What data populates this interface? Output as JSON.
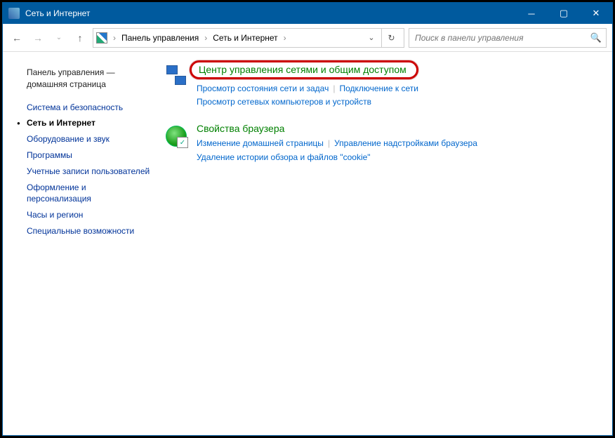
{
  "window": {
    "title": "Сеть и Интернет"
  },
  "crumbs": {
    "root": "Панель управления",
    "section": "Сеть и Интернет"
  },
  "search": {
    "placeholder": "Поиск в панели управления"
  },
  "sidebar": {
    "home": "Панель управления — домашняя страница",
    "items": [
      "Система и безопасность",
      "Сеть и Интернет",
      "Оборудование и звук",
      "Программы",
      "Учетные записи пользователей",
      "Оформление и персонализация",
      "Часы и регион",
      "Специальные возможности"
    ],
    "active_index": 1
  },
  "blocks": [
    {
      "heading": "Центр управления сетями и общим доступом",
      "highlight": true,
      "icon": "net",
      "tasks_rows": [
        [
          "Просмотр состояния сети и задач",
          "Подключение к сети"
        ],
        [
          "Просмотр сетевых компьютеров и устройств"
        ]
      ]
    },
    {
      "heading": "Свойства браузера",
      "highlight": false,
      "icon": "browser",
      "tasks_rows": [
        [
          "Изменение домашней страницы",
          "Управление надстройками браузера"
        ],
        [
          "Удаление истории обзора и файлов \"cookie\""
        ]
      ]
    }
  ]
}
